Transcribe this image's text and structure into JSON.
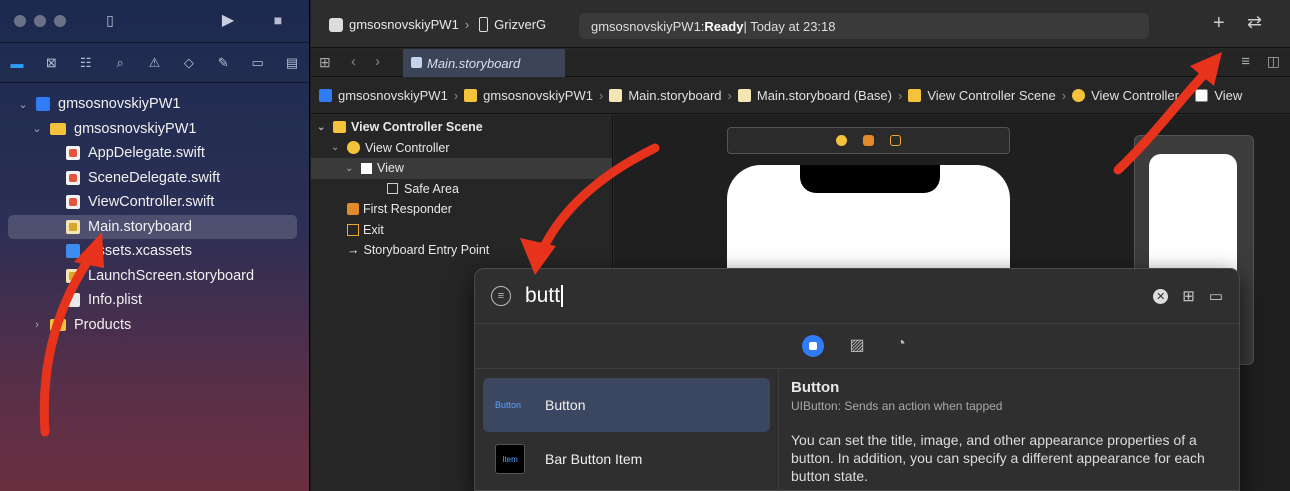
{
  "navigator": {
    "items": [
      {
        "label": "gmsosnovskiyPW1",
        "icon": "project-icon"
      },
      {
        "label": "gmsosnovskiyPW1",
        "icon": "folder-icon"
      },
      {
        "label": "AppDelegate.swift",
        "icon": "swift-file-icon"
      },
      {
        "label": "SceneDelegate.swift",
        "icon": "swift-file-icon"
      },
      {
        "label": "ViewController.swift",
        "icon": "swift-file-icon"
      },
      {
        "label": "Main.storyboard",
        "icon": "storyboard-icon"
      },
      {
        "label": "Assets.xcassets",
        "icon": "assets-icon"
      },
      {
        "label": "LaunchScreen.storyboard",
        "icon": "storyboard-icon"
      },
      {
        "label": "Info.plist",
        "icon": "plist-icon"
      },
      {
        "label": "Products",
        "icon": "folder-icon"
      }
    ]
  },
  "toolbar": {
    "scheme": "gmsosnovskiyPW1",
    "destination": "GrizverG",
    "status_project": "gmsosnovskiyPW1: ",
    "status_state": "Ready",
    "status_time": " | Today at 23:18",
    "add_label": "+",
    "swap_label": "⇄"
  },
  "tab": {
    "title": "Main.storyboard"
  },
  "jumpbar": [
    "gmsosnovskiyPW1",
    "gmsosnovskiyPW1",
    "Main.storyboard",
    "Main.storyboard (Base)",
    "View Controller Scene",
    "View Controller",
    "View"
  ],
  "outline": {
    "items": [
      "View Controller Scene",
      "View Controller",
      "View",
      "Safe Area",
      "First Responder",
      "Exit",
      "Storyboard Entry Point"
    ]
  },
  "library": {
    "query": "butt",
    "results": [
      {
        "thumb": "Button",
        "label": "Button"
      },
      {
        "thumb": "Item",
        "label": "Bar Button Item"
      }
    ],
    "detail_title": "Button",
    "detail_sub": "UIButton: Sends an action when tapped",
    "detail_text": "You can set the title, image, and other appearance properties of a button. In addition, you can specify a different appearance for each button state."
  },
  "colors": {
    "accent": "#2f7cf6",
    "arrow": "#e8331c",
    "selection": "#3b4760"
  }
}
